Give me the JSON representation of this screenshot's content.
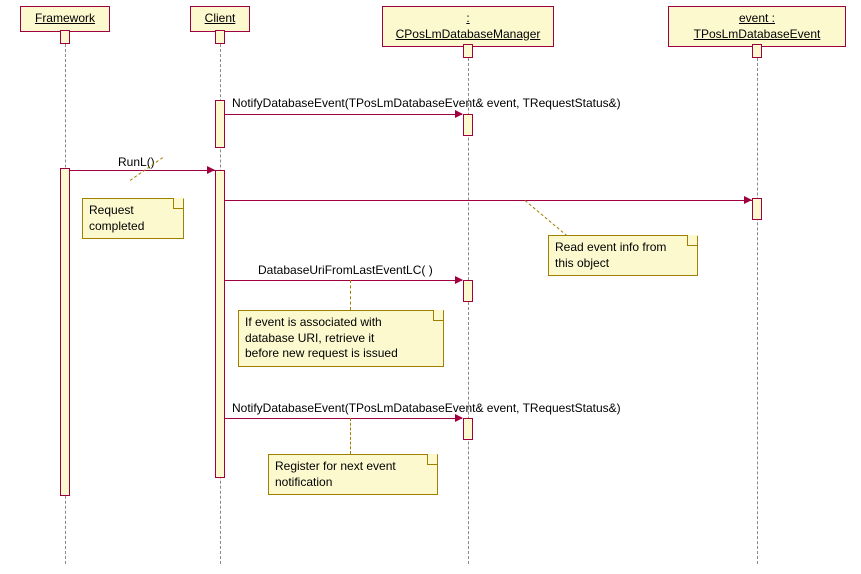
{
  "lifelines": {
    "framework": {
      "label": "Framework"
    },
    "client": {
      "label": "Client"
    },
    "dbmgr_prefix": ":",
    "dbmgr_name": "CPosLmDatabaseManager",
    "event_prefix": "event :",
    "event_name": "TPosLmDatabaseEvent"
  },
  "messages": {
    "notify1": "NotifyDatabaseEvent(TPosLmDatabaseEvent& event, TRequestStatus&)",
    "runl": "RunL()",
    "dburi": "DatabaseUriFromLastEventLC( )",
    "notify2": "NotifyDatabaseEvent(TPosLmDatabaseEvent& event, TRequestStatus&)"
  },
  "notes": {
    "reqcomplete": "Request\ncompleted",
    "readevent": "Read event info from\nthis object",
    "ifevent": "If event is associated with\ndatabase URI, retrieve it\nbefore new request is issued",
    "register": "Register for next event\nnotification"
  },
  "chart_data": {
    "type": "sequence-diagram",
    "participants": [
      {
        "id": "Framework",
        "label": "Framework"
      },
      {
        "id": "Client",
        "label": "Client"
      },
      {
        "id": "CPosLmDatabaseManager",
        "label": ": CPosLmDatabaseManager"
      },
      {
        "id": "TPosLmDatabaseEvent",
        "label": "event : TPosLmDatabaseEvent"
      }
    ],
    "messages": [
      {
        "from": "Client",
        "to": "CPosLmDatabaseManager",
        "label": "NotifyDatabaseEvent(TPosLmDatabaseEvent& event, TRequestStatus&)"
      },
      {
        "from": "Framework",
        "to": "Client",
        "label": "RunL()",
        "note": "Request completed"
      },
      {
        "from": "Client",
        "to": "TPosLmDatabaseEvent",
        "label": "",
        "note": "Read event info from this object"
      },
      {
        "from": "Client",
        "to": "CPosLmDatabaseManager",
        "label": "DatabaseUriFromLastEventLC( )",
        "note": "If event is associated with database URI, retrieve it before new request is issued"
      },
      {
        "from": "Client",
        "to": "CPosLmDatabaseManager",
        "label": "NotifyDatabaseEvent(TPosLmDatabaseEvent& event, TRequestStatus&)",
        "note": "Register for next event notification"
      }
    ]
  }
}
